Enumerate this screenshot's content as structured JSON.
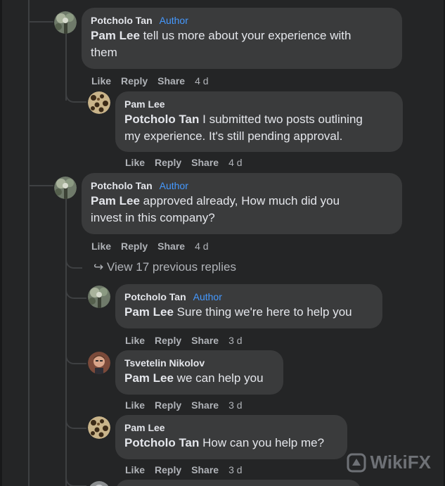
{
  "comments": [
    {
      "author": "Potcholo Tan",
      "badge": "Author",
      "mention": "Pam Lee",
      "text_l1": " tell us more about your experience with",
      "text_l2": "them",
      "actions": {
        "like": "Like",
        "reply": "Reply",
        "share": "Share",
        "time": "4 d"
      }
    },
    {
      "author": "Pam Lee",
      "badge": "",
      "mention": "Potcholo Tan",
      "text_l1": " I submitted two posts outlining",
      "text_l2": "my experience. It's still pending approval.",
      "actions": {
        "like": "Like",
        "reply": "Reply",
        "share": "Share",
        "time": "4 d"
      }
    },
    {
      "author": "Potcholo Tan",
      "badge": "Author",
      "mention": "Pam Lee",
      "text_l1": " approved already, How much did you",
      "text_l2": "invest in this company?",
      "actions": {
        "like": "Like",
        "reply": "Reply",
        "share": "Share",
        "time": "4 d"
      }
    },
    {
      "author": "Potcholo Tan",
      "badge": "Author",
      "mention": "Pam Lee",
      "text_l1": " Sure thing we're here to help you",
      "actions": {
        "like": "Like",
        "reply": "Reply",
        "share": "Share",
        "time": "3 d"
      }
    },
    {
      "author": "Tsvetelin Nikolov",
      "badge": "",
      "mention": "Pam Lee",
      "text_l1": " we can help you",
      "actions": {
        "like": "Like",
        "reply": "Reply",
        "share": "Share",
        "time": "3 d"
      }
    },
    {
      "author": "Pam Lee",
      "badge": "",
      "mention": "Potcholo Tan",
      "text_l1": " How can you help me?",
      "actions": {
        "like": "Like",
        "reply": "Reply",
        "share": "Share",
        "time": "3 d"
      }
    }
  ],
  "view_previous": "View 17 previous replies",
  "watermark": "WikiFX",
  "icons": {
    "reply_arrow": "reply-arrow-icon",
    "watermark_logo": "wikifx-logo-icon"
  },
  "colors": {
    "background": "#242526",
    "bubble": "#3a3b3c",
    "author_badge": "#4599ff",
    "muted": "#b0b3b8"
  }
}
